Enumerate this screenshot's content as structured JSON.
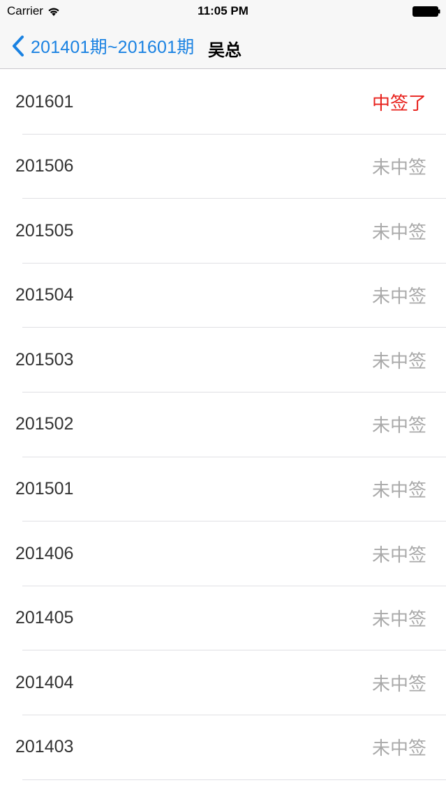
{
  "status_bar": {
    "carrier": "Carrier",
    "time": "11:05 PM"
  },
  "nav": {
    "back_label": "201401期~201601期",
    "title": "吴总"
  },
  "colors": {
    "accent": "#1a82e2",
    "win": "#e8211c",
    "lose": "#a9a9a9"
  },
  "rows": [
    {
      "period": "201601",
      "result": "中签了",
      "won": true
    },
    {
      "period": "201506",
      "result": "未中签",
      "won": false
    },
    {
      "period": "201505",
      "result": "未中签",
      "won": false
    },
    {
      "period": "201504",
      "result": "未中签",
      "won": false
    },
    {
      "period": "201503",
      "result": "未中签",
      "won": false
    },
    {
      "period": "201502",
      "result": "未中签",
      "won": false
    },
    {
      "period": "201501",
      "result": "未中签",
      "won": false
    },
    {
      "period": "201406",
      "result": "未中签",
      "won": false
    },
    {
      "period": "201405",
      "result": "未中签",
      "won": false
    },
    {
      "period": "201404",
      "result": "未中签",
      "won": false
    },
    {
      "period": "201403",
      "result": "未中签",
      "won": false
    }
  ]
}
